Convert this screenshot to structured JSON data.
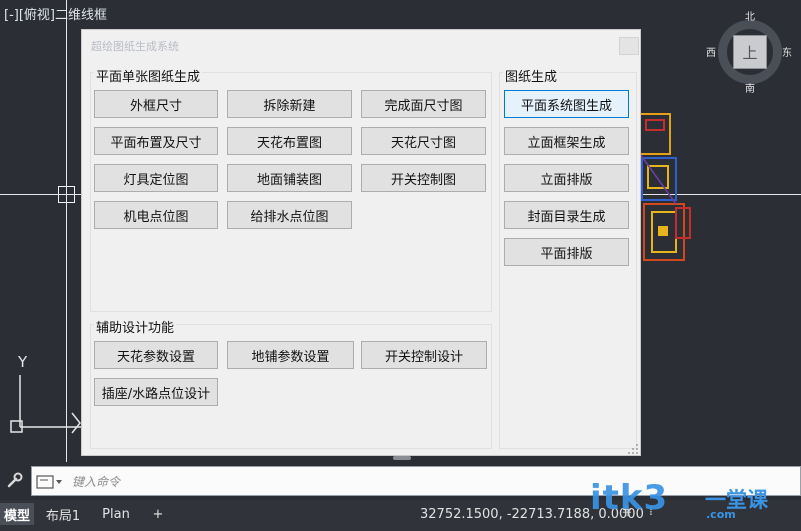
{
  "viewport": {
    "label": "[-][俯视]二维线框",
    "ucs_y_label": "Y"
  },
  "viewcube": {
    "top_face": "上",
    "north": "北",
    "south": "南",
    "west": "西",
    "east": "东"
  },
  "dialog": {
    "title": "超绘图纸生成系统",
    "plan_group": {
      "label": "平面单张图纸生成",
      "buttons": [
        "外框尺寸",
        "拆除新建",
        "完成面尺寸图",
        "平面布置及尺寸",
        "天花布置图",
        "天花尺寸图",
        "灯具定位图",
        "地面铺装图",
        "开关控制图",
        "机电点位图",
        "给排水点位图"
      ]
    },
    "aux_group": {
      "label": "辅助设计功能",
      "buttons": [
        "天花参数设置",
        "地铺参数设置",
        "开关控制设计",
        "插座/水路点位设计"
      ]
    },
    "drawing_group": {
      "label": "图纸生成",
      "buttons": [
        "平面系统图生成",
        "立面框架生成",
        "立面排版",
        "封面目录生成",
        "平面排版"
      ]
    }
  },
  "command_line": {
    "placeholder": "键入命令"
  },
  "statusbar": {
    "tabs": [
      "模型",
      "布局1",
      "Plan"
    ],
    "add_tab": "+",
    "coordinates": "32752.1500, -22713.7188, 0.0000"
  },
  "watermark": {
    "text": "itk3",
    "sub": "一堂课",
    "url": ".com"
  },
  "colors": {
    "accent": "#0078d7",
    "watermark": "#3a93e4"
  }
}
